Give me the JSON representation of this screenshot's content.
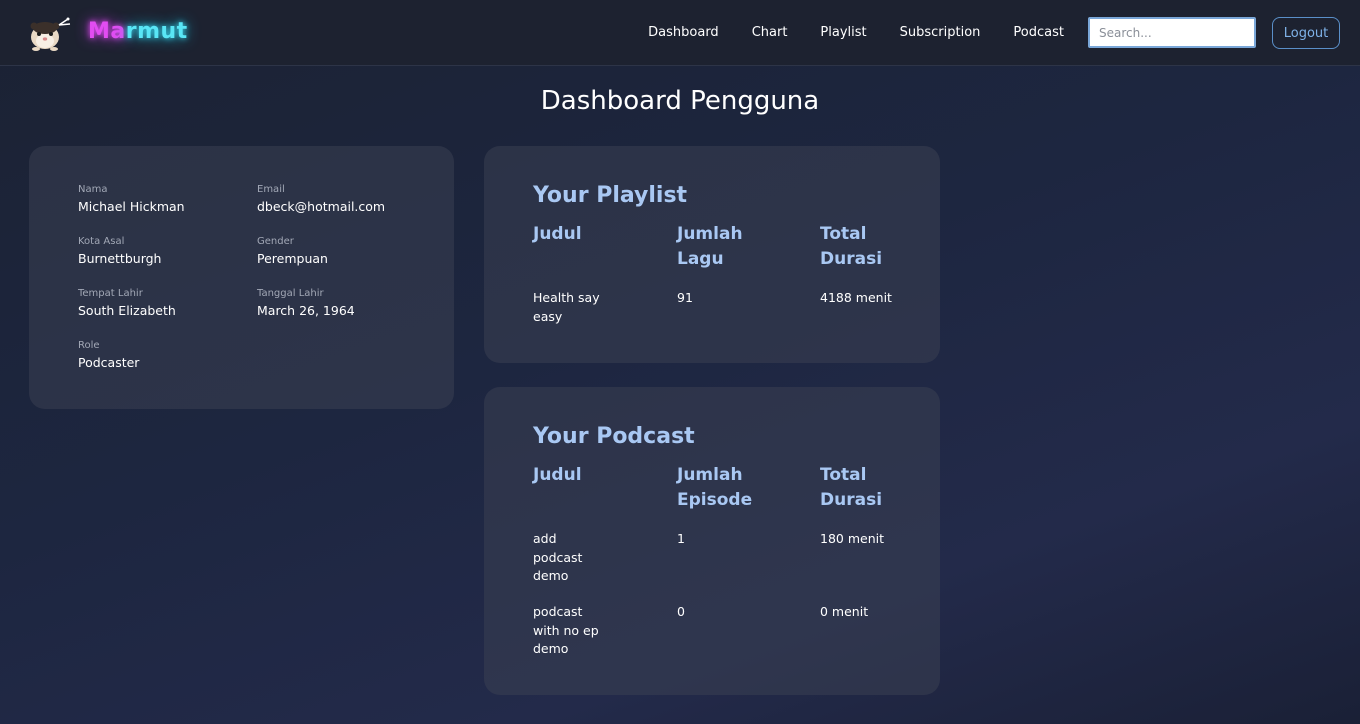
{
  "app": {
    "brand_part1": "Ma",
    "brand_part2": "rmut",
    "logo_icon": "hamster-icon"
  },
  "nav": {
    "items": [
      {
        "label": "Dashboard"
      },
      {
        "label": "Chart"
      },
      {
        "label": "Playlist"
      },
      {
        "label": "Subscription"
      },
      {
        "label": "Podcast"
      }
    ],
    "search_placeholder": "Search...",
    "logout_label": "Logout"
  },
  "page": {
    "title": "Dashboard Pengguna"
  },
  "profile": {
    "nama_label": "Nama",
    "nama": "Michael Hickman",
    "email_label": "Email",
    "email": "dbeck@hotmail.com",
    "kota_label": "Kota Asal",
    "kota": "Burnettburgh",
    "gender_label": "Gender",
    "gender": "Perempuan",
    "tempat_label": "Tempat Lahir",
    "tempat": "South Elizabeth",
    "tanggal_label": "Tanggal Lahir",
    "tanggal": "March 26, 1964",
    "role_label": "Role",
    "role": "Podcaster"
  },
  "playlist": {
    "title": "Your Playlist",
    "headers": [
      "Judul",
      "Jumlah Lagu",
      "Total Durasi"
    ],
    "rows": [
      {
        "judul": "Health say easy",
        "jumlah": "91",
        "durasi": "4188 menit"
      }
    ]
  },
  "podcast": {
    "title": "Your Podcast",
    "headers": [
      "Judul",
      "Jumlah Episode",
      "Total Durasi"
    ],
    "rows": [
      {
        "judul": "add podcast demo",
        "jumlah": "1",
        "durasi": "180 menit"
      },
      {
        "judul": "podcast with no ep demo",
        "jumlah": "0",
        "durasi": "0 menit"
      }
    ]
  },
  "colors": {
    "accent": "#a9c8f3",
    "logout_border": "#5a8fc8",
    "brand_pink": "#e24cf2",
    "brand_cyan": "#59e6f6"
  }
}
